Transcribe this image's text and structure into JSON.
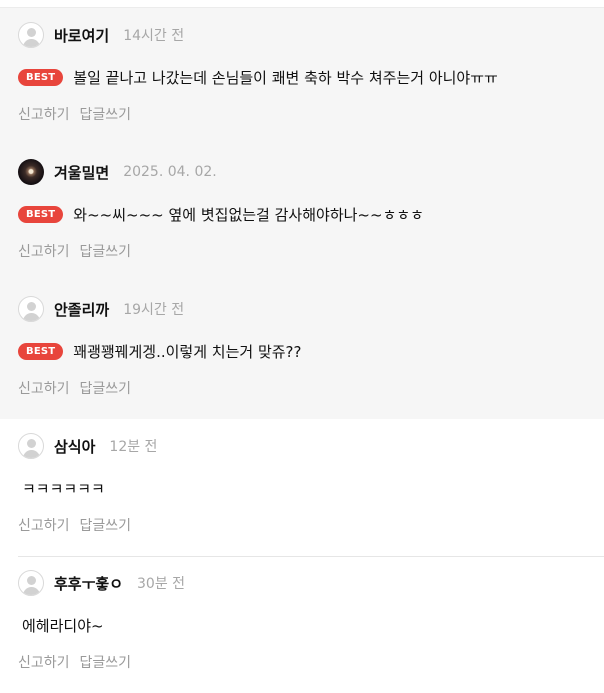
{
  "comments": [
    {
      "avatar": "default-avatar",
      "nickname": "바로여기",
      "time": "14시간 전",
      "badge": "BEST",
      "text": "볼일 끝나고 나갔는데 손님들이 쾌변 축하 박수 쳐주는거 아니야ㅠㅠ",
      "report_label": "신고하기",
      "reply_label": "답글쓰기"
    },
    {
      "avatar": "photo-avatar",
      "nickname": "겨울밀면",
      "time": "2025. 04. 02.",
      "badge": "BEST",
      "text": "와~~씨~~~ 옆에 볏집없는걸 감사해야하나~~ㅎㅎㅎ",
      "report_label": "신고하기",
      "reply_label": "답글쓰기"
    },
    {
      "avatar": "default-avatar",
      "nickname": "안졸리까",
      "time": "19시간 전",
      "badge": "BEST",
      "text": "꽤괭꽹꿰게겡..이렇게 치는거 맞쥬??",
      "report_label": "신고하기",
      "reply_label": "답글쓰기"
    },
    {
      "avatar": "default-avatar",
      "nickname": "삼식아",
      "time": "12분 전",
      "text": "ㅋㅋㅋㅋㅋㅋ",
      "report_label": "신고하기",
      "reply_label": "답글쓰기"
    },
    {
      "avatar": "default-avatar",
      "nickname": "후후ㅜ훟ㅇ",
      "time": "30분 전",
      "text": "에헤라디야~",
      "report_label": "신고하기",
      "reply_label": "답글쓰기"
    }
  ],
  "colors": {
    "best_badge": "#e8453c",
    "best_background": "#f6f6f6",
    "meta_text": "#a7a7a7",
    "action_text": "#9a9a9a"
  }
}
